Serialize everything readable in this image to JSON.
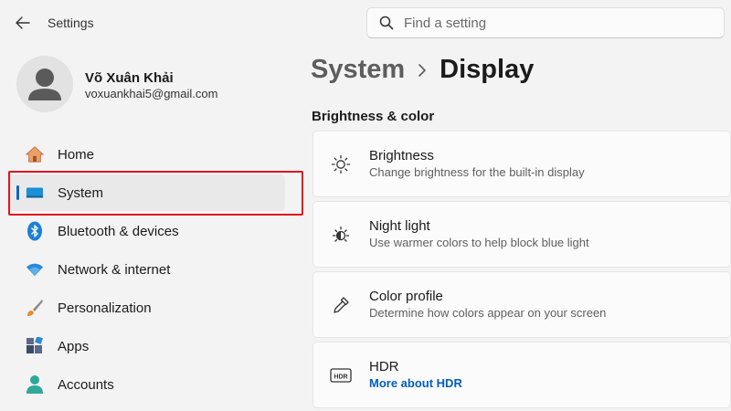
{
  "window": {
    "title": "Settings"
  },
  "search": {
    "placeholder": "Find a setting"
  },
  "profile": {
    "name": "Võ Xuân Khải",
    "email": "voxuankhai5@gmail.com"
  },
  "sidebar": {
    "items": [
      {
        "label": "Home",
        "icon": "home-icon"
      },
      {
        "label": "System",
        "icon": "system-icon",
        "active": true
      },
      {
        "label": "Bluetooth & devices",
        "icon": "bluetooth-icon"
      },
      {
        "label": "Network & internet",
        "icon": "wifi-icon"
      },
      {
        "label": "Personalization",
        "icon": "brush-icon"
      },
      {
        "label": "Apps",
        "icon": "apps-icon"
      },
      {
        "label": "Accounts",
        "icon": "accounts-icon"
      }
    ]
  },
  "breadcrumb": {
    "parent": "System",
    "separator": ">",
    "current": "Display"
  },
  "section": {
    "title": "Brightness & color"
  },
  "cards": [
    {
      "title": "Brightness",
      "description": "Change brightness for the built-in display",
      "icon": "sun-icon"
    },
    {
      "title": "Night light",
      "description": "Use warmer colors to help block blue light",
      "icon": "night-light-icon"
    },
    {
      "title": "Color profile",
      "description": "Determine how colors appear on your screen",
      "icon": "eyedropper-icon"
    },
    {
      "title": "HDR",
      "link": "More about HDR",
      "icon": "hdr-icon"
    }
  ],
  "colors": {
    "accent": "#0067c0",
    "highlight": "#e0141e",
    "link": "#005fb8"
  }
}
